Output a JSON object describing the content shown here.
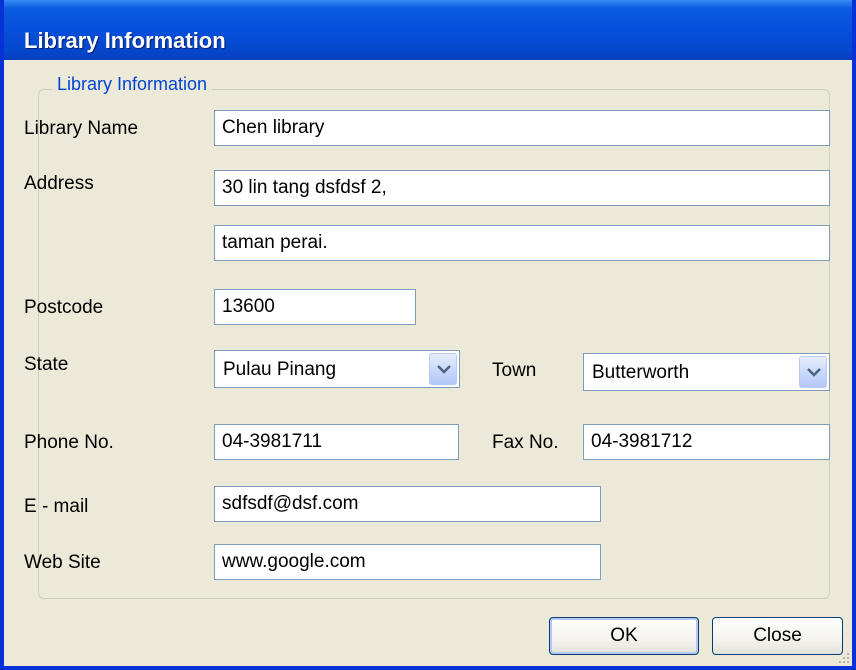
{
  "window": {
    "title": "Library Information"
  },
  "form": {
    "group_title": "Library Information",
    "library_name": {
      "label": "Library Name",
      "value": "Chen library"
    },
    "address": {
      "label": "Address",
      "line1": "30 lin tang dsfdsf 2,",
      "line2": "taman perai."
    },
    "postcode": {
      "label": "Postcode",
      "value": "13600"
    },
    "state": {
      "label": "State",
      "value": "Pulau Pinang"
    },
    "town": {
      "label": "Town",
      "value": "Butterworth"
    },
    "phone": {
      "label": "Phone No.",
      "value": "04-3981711"
    },
    "fax": {
      "label": "Fax No.",
      "value": "04-3981712"
    },
    "email": {
      "label": "E - mail",
      "value": "sdfsdf@dsf.com"
    },
    "website": {
      "label": "Web Site",
      "value": "www.google.com"
    }
  },
  "buttons": {
    "ok": "OK",
    "close": "Close"
  },
  "icons": {
    "dropdown": "chevron-down-icon",
    "resize": "resize-grip-icon"
  },
  "colors": {
    "title_bar": "#0a5ae0",
    "dialog_bg": "#ece9d8",
    "group_title": "#0046d5",
    "field_border": "#7f9db9"
  }
}
